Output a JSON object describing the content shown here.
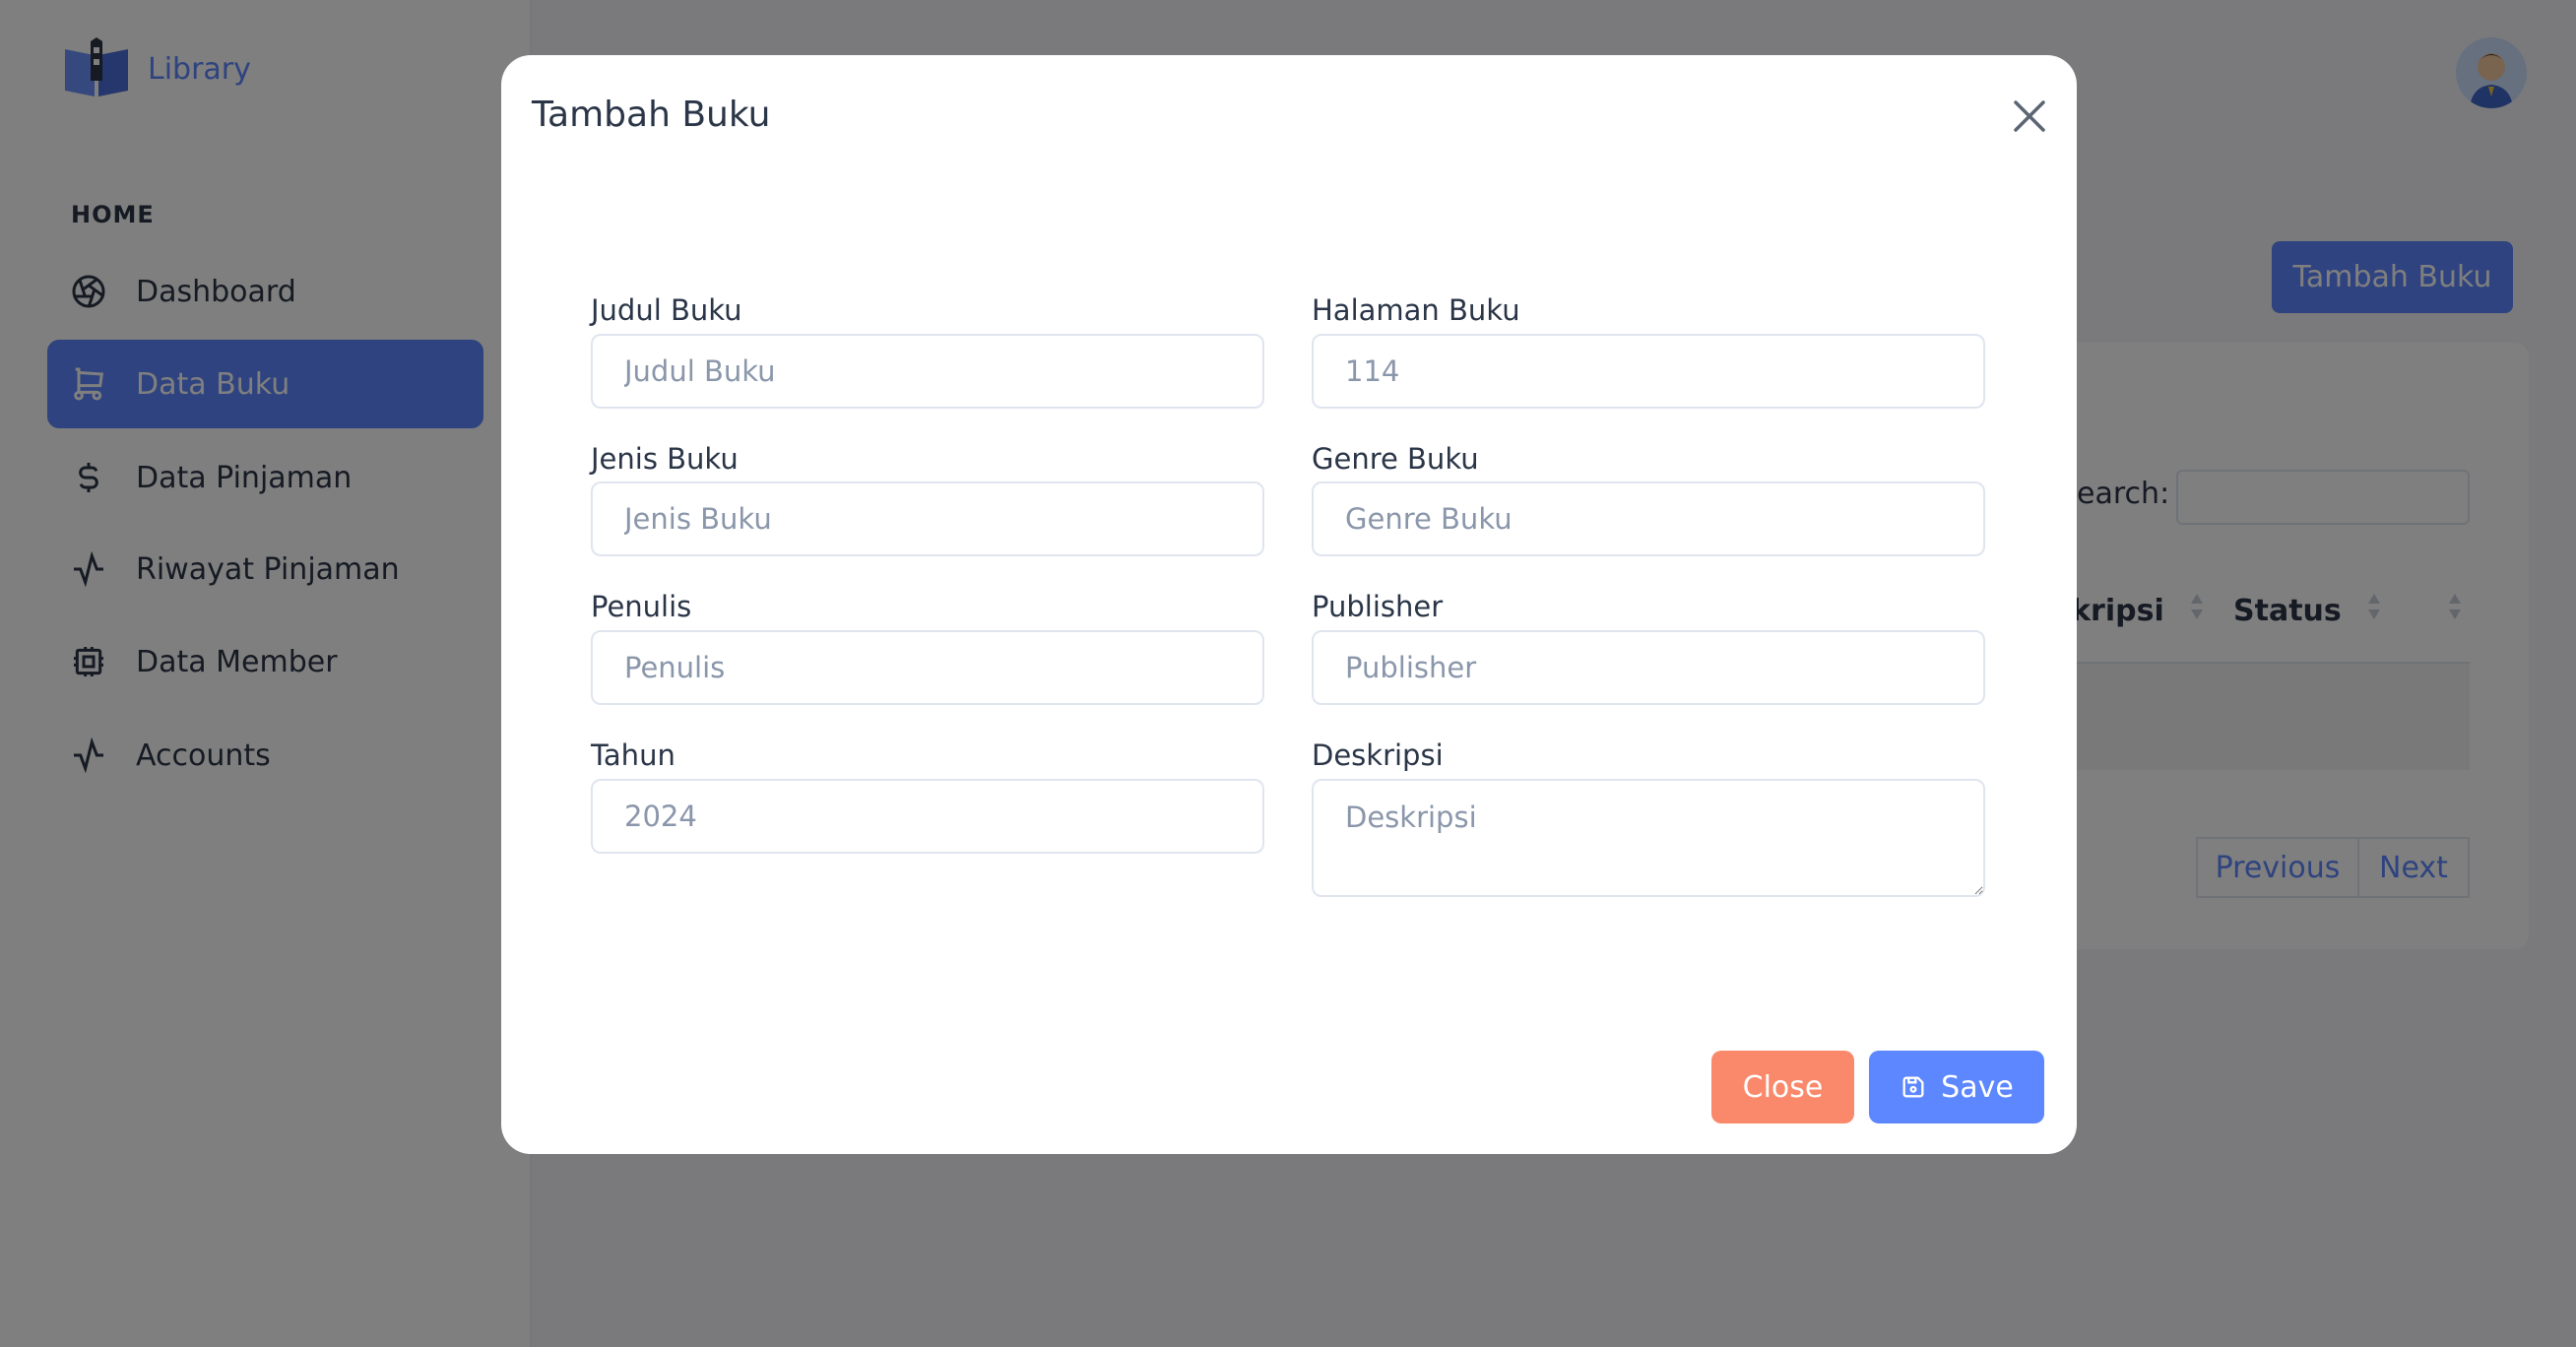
{
  "sidebar": {
    "brand": "Library",
    "section_heading": "HOME",
    "items": [
      {
        "label": "Dashboard",
        "icon": "aperture-icon"
      },
      {
        "label": "Data Buku",
        "icon": "cart-icon",
        "active": true
      },
      {
        "label": "Data Pinjaman",
        "icon": "dollar-icon"
      },
      {
        "label": "Riwayat Pinjaman",
        "icon": "activity-icon"
      },
      {
        "label": "Data Member",
        "icon": "cpu-icon"
      },
      {
        "label": "Accounts",
        "icon": "activity-icon"
      }
    ]
  },
  "page": {
    "add_button": "Tambah Buku",
    "search_label": "Search:",
    "columns": [
      "Deskripsi",
      "Status",
      ""
    ],
    "previous": "Previous",
    "next": "Next"
  },
  "modal": {
    "title": "Tambah Buku",
    "fields": {
      "judul": {
        "label": "Judul Buku",
        "placeholder": "Judul Buku",
        "value": ""
      },
      "halaman": {
        "label": "Halaman Buku",
        "placeholder": "114",
        "value": ""
      },
      "jenis": {
        "label": "Jenis Buku",
        "placeholder": "Jenis Buku",
        "value": ""
      },
      "genre": {
        "label": "Genre Buku",
        "placeholder": "Genre Buku",
        "value": ""
      },
      "penulis": {
        "label": "Penulis",
        "placeholder": "Penulis",
        "value": ""
      },
      "publisher": {
        "label": "Publisher",
        "placeholder": "Publisher",
        "value": ""
      },
      "tahun": {
        "label": "Tahun",
        "placeholder": "2024",
        "value": ""
      },
      "deskripsi": {
        "label": "Deskripsi",
        "placeholder": "Deskripsi",
        "value": ""
      }
    },
    "close_button": "Close",
    "save_button": "Save"
  },
  "colors": {
    "primary": "#5d87ff",
    "danger": "#fa896b",
    "overlay": "rgba(0,0,0,0.5)"
  }
}
